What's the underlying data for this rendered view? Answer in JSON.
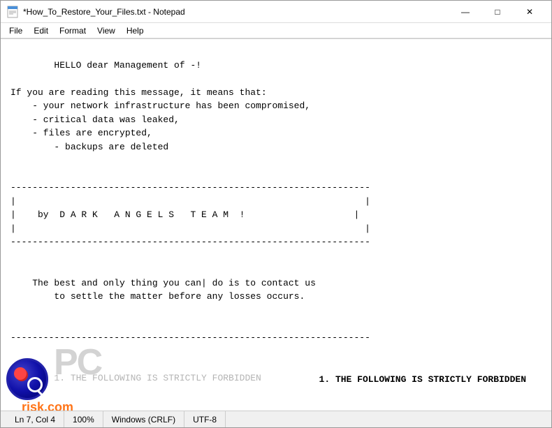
{
  "window": {
    "title": "*How_To_Restore_Your_Files.txt - Notepad",
    "icon": "notepad-icon"
  },
  "title_controls": {
    "minimize": "—",
    "maximize": "□",
    "close": "✕"
  },
  "menu": {
    "items": [
      "File",
      "Edit",
      "Format",
      "View",
      "Help"
    ]
  },
  "content": {
    "line1": "",
    "body": "        HELLO dear Management of -!\n\nIf you are reading this message, it means that:\n    - your network infrastructure has been compromised,\n    - critical data was leaked,\n    - files are encrypted,\n        - backups are deleted\n\n\n------------------------------------------------------------------\n|\t\t\t\t\t\t\t\t\t |\n|\t   by  D A R K   A N G E L S   T E A M  !\t\t |\n|\t\t\t\t\t\t\t\t\t |\n------------------------------------------------------------------\n\n\n    The best and only thing you can| do is to contact us\n        to settle the matter before any losses occurs.\n\n\n------------------------------------------------------------------\n\n\n        1. THE FOLLOWING IS STRICTLY FORBIDDEN"
  },
  "status_bar": {
    "position": "Ln 7, Col 4",
    "zoom": "100%",
    "line_ending": "Windows (CRLF)",
    "encoding": "UTF-8"
  },
  "watermark": {
    "pc_text": "PC",
    "risk_text": "risk.com",
    "right_text": "1. THE FOLLOWING IS STRICTLY FORBIDDEN"
  }
}
